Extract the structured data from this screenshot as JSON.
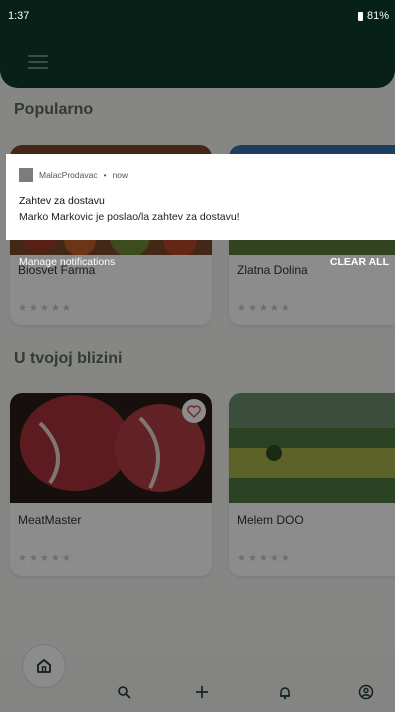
{
  "status_bar": {
    "time": "1:37",
    "battery": "81%"
  },
  "sections": {
    "popular_title": "Popularno",
    "nearby_title": "U tvojoj blizini"
  },
  "popular_cards": [
    {
      "name": "Biosvet Farma",
      "stars": "★★★★★"
    },
    {
      "name": "Zlatna Dolina",
      "stars": "★★★★★"
    }
  ],
  "nearby_cards": [
    {
      "name": "MeatMaster",
      "stars": "★★★★★"
    },
    {
      "name": "Melem DOO",
      "stars": "★★★★★"
    }
  ],
  "notification": {
    "app_name": "MalacProdavac",
    "time": "now",
    "title": "Zahtev za dostavu",
    "body": "Marko Markovic je poslao/la zahtev za dostavu!"
  },
  "shade": {
    "manage": "Manage notifications",
    "clear_all": "CLEAR ALL"
  },
  "nav": {
    "home_icon": "home-icon",
    "search_icon": "search-icon",
    "add_icon": "plus-icon",
    "bell_icon": "bell-icon",
    "profile_icon": "profile-icon"
  },
  "colors": {
    "header": "#0e3b2d",
    "accent": "#1c3a2f"
  }
}
